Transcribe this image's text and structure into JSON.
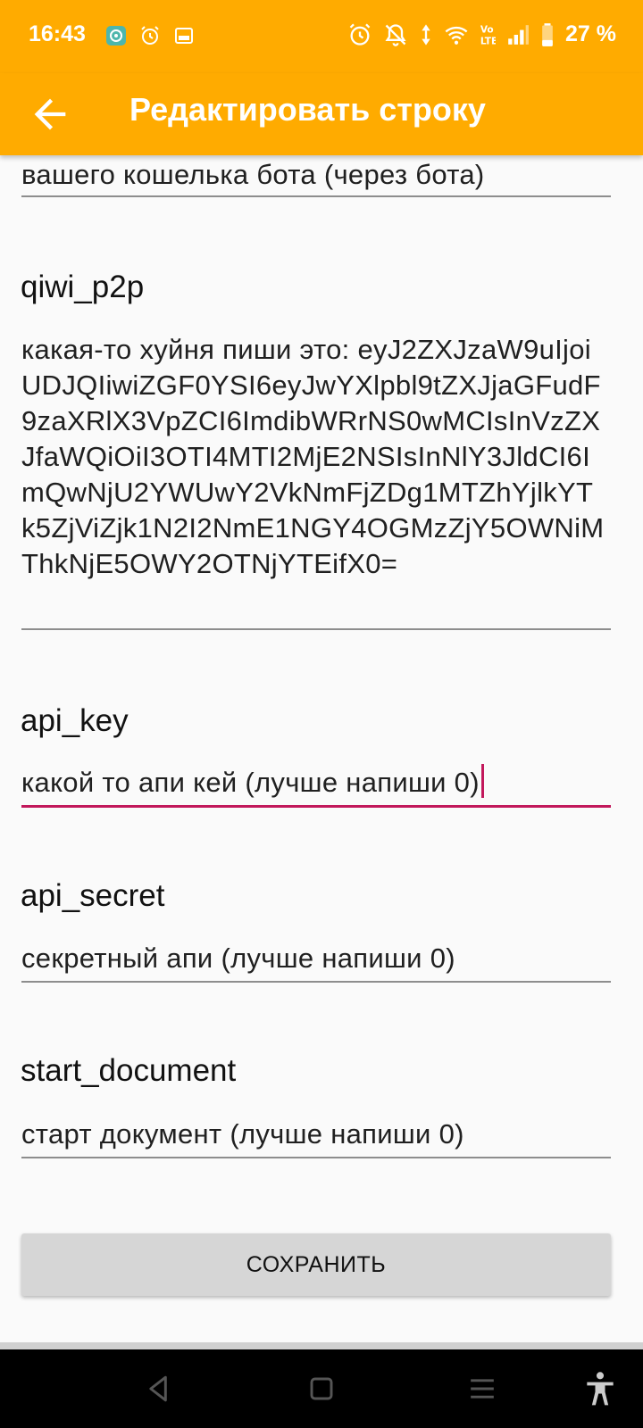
{
  "status_bar": {
    "time": "16:43",
    "battery": "27 %"
  },
  "app_bar": {
    "title": "Редактировать строку",
    "back_icon": "arrow-left-icon"
  },
  "fields": {
    "wallet": {
      "value": "вашего кошелька бота (через бота)"
    },
    "qiwi_p2p": {
      "label": "qiwi_p2p",
      "value": "какая-то хуйня пиши это: eyJ2ZXJzaW9uIjoiUDJQIiwiZGF0YSI6eyJwYXlpbl9tZXJjaGFudF9zaXRlX3VpZCI6ImdibWRrNS0wMCIsInVzZXJfaWQiOiI3OTI4MTI2MjE2NSIsInNlY3JldCI6ImQwNjU2YWUwY2VkNmFjZDg1MTZhYjlkYTk5ZjViZjk1N2I2NmE1NGY4OGMzZjY5OWNiMThkNjE5OWY2OTNjYTEifX0="
    },
    "api_key": {
      "label": "api_key",
      "value": "какой то апи кей (лучше напиши 0)"
    },
    "api_secret": {
      "label": "api_secret",
      "value": "секретный апи (лучше напиши 0)"
    },
    "start_document": {
      "label": "start_document",
      "value": "старт документ (лучше напиши 0)"
    }
  },
  "save_button": {
    "label": "СОХРАНИТЬ"
  },
  "colors": {
    "accent": "#ffab00",
    "focus": "#c2185b"
  }
}
